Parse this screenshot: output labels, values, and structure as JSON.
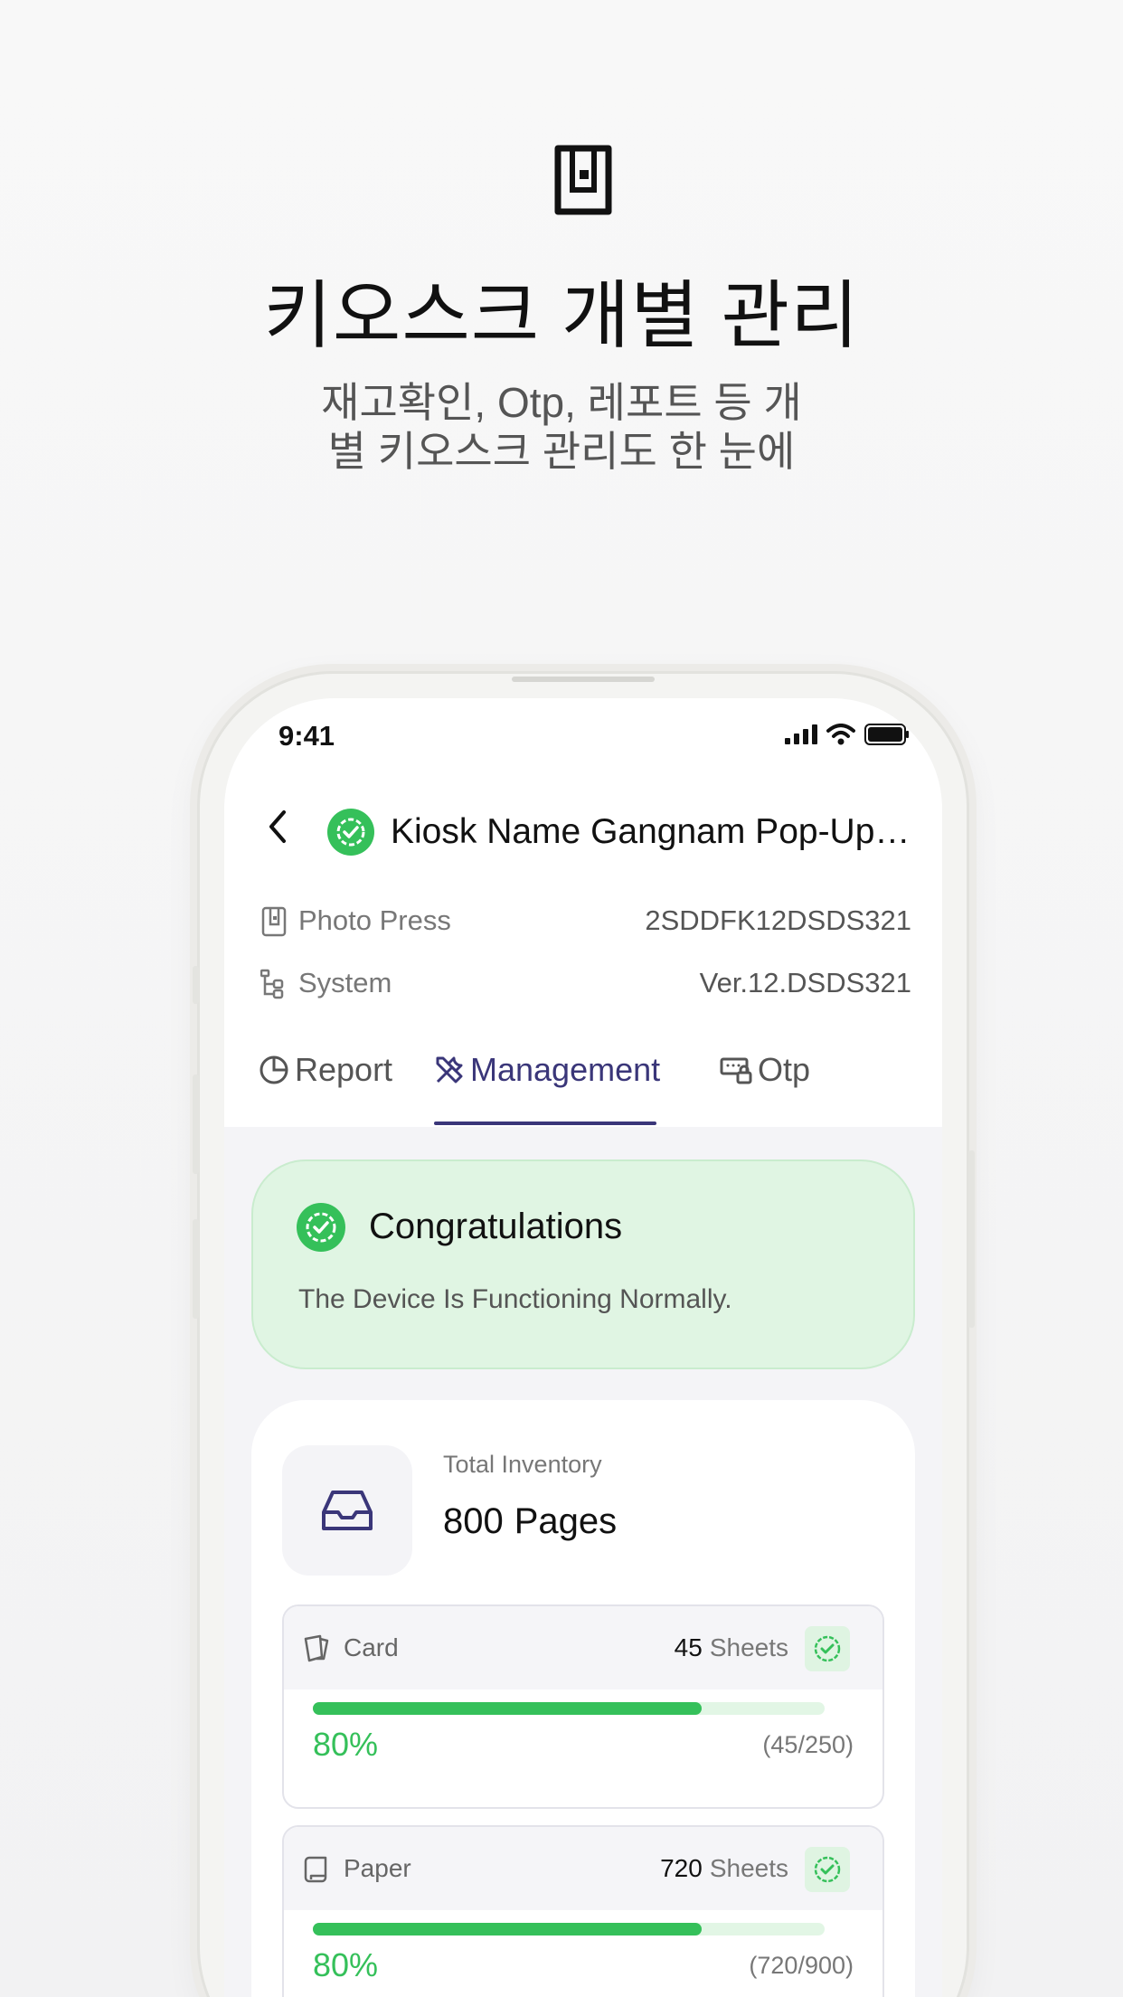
{
  "hero": {
    "title": "키오스크 개별 관리",
    "subtitle_line1": "재고확인, Otp, 레포트 등 개",
    "subtitle_line2": "별 키오스크 관리도 한 눈에",
    "icon": "kiosk-icon"
  },
  "status_bar": {
    "time": "9:41",
    "icons": [
      "signal-icon",
      "wifi-icon",
      "battery-icon"
    ]
  },
  "header": {
    "back_icon": "chevron-left-icon",
    "status_icon": "verified-check-icon",
    "title": "Kiosk Name Gangnam Pop-Up…"
  },
  "info": {
    "rows": [
      {
        "icon": "kiosk-small-icon",
        "label": "Photo Press",
        "value": "2SDDFK12DSDS321"
      },
      {
        "icon": "tree-icon",
        "label": "System",
        "value": "Ver.12.DSDS321"
      }
    ]
  },
  "tabs": [
    {
      "icon": "pie-chart-icon",
      "label": "Report",
      "active": false
    },
    {
      "icon": "tools-icon",
      "label": "Management",
      "active": true
    },
    {
      "icon": "keyboard-lock-icon",
      "label": "Otp",
      "active": false
    }
  ],
  "congrats": {
    "title": "Congratulations",
    "message": "The Device Is Functioning Normally."
  },
  "inventory": {
    "label": "Total Inventory",
    "total": "800",
    "unit": "Pages",
    "items": [
      {
        "icon": "card-icon",
        "name": "Card",
        "count": "45",
        "unit": "Sheets",
        "progress": 0.76,
        "percent_text": "80%",
        "fraction_text": "(45/250)"
      },
      {
        "icon": "paper-icon",
        "name": "Paper",
        "count": "720",
        "unit": "Sheets",
        "progress": 0.76,
        "percent_text": "80%",
        "fraction_text": "(720/900)"
      }
    ]
  },
  "colors": {
    "accent": "#3a3679",
    "success": "#35c05a",
    "success_bg": "#e0f5e3"
  }
}
